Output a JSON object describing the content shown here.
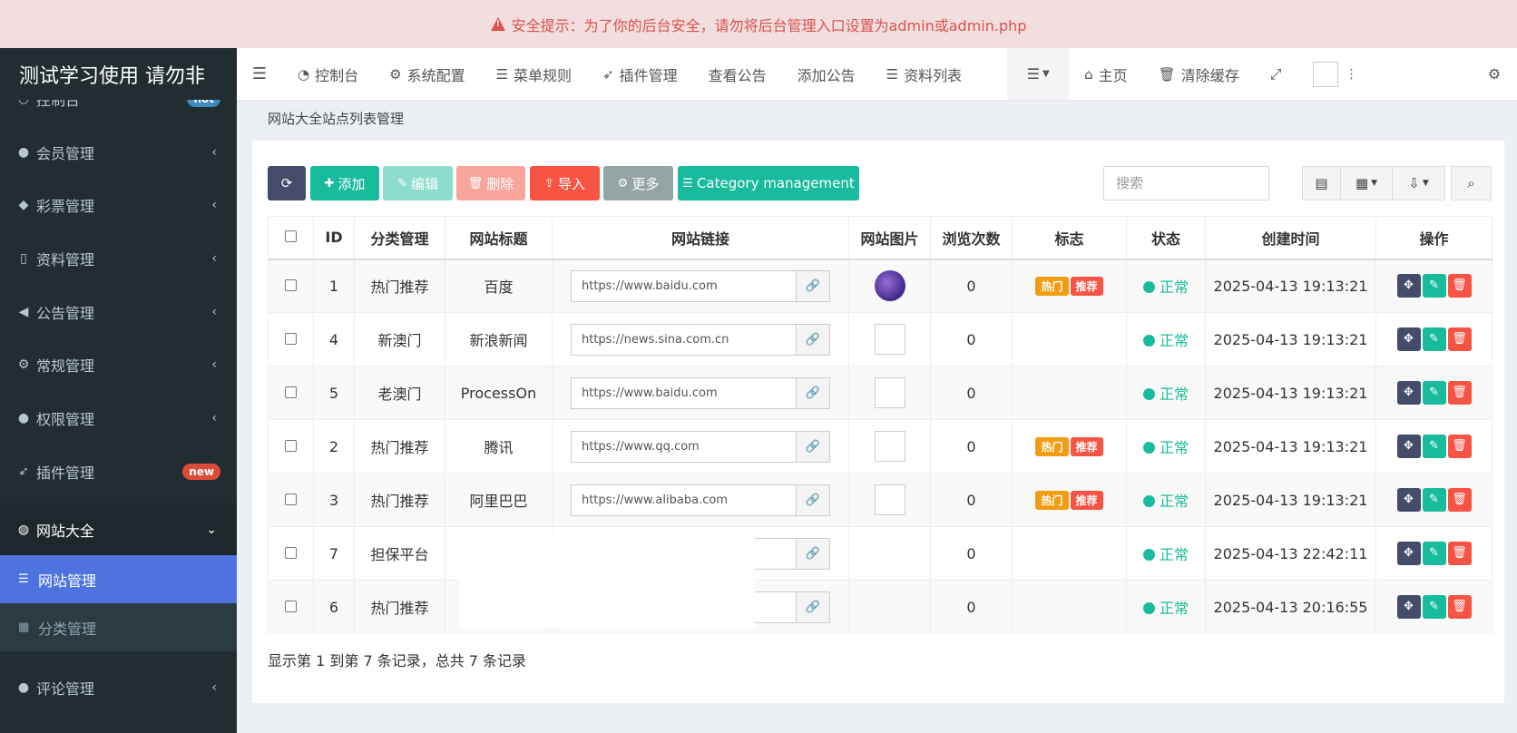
{
  "alert": {
    "text": "安全提示：为了你的后台安全，请勿将后台管理入口设置为admin或admin.php"
  },
  "sidebar": {
    "brand": "测试学习使用 请勿非",
    "items": [
      {
        "label": "控制台",
        "icon": "dashboard-icon",
        "badge": "hot",
        "badge_color": "#3c8dbc"
      },
      {
        "label": "会员管理",
        "icon": "user-icon"
      },
      {
        "label": "彩票管理",
        "icon": "ticket-icon"
      },
      {
        "label": "资料管理",
        "icon": "file-icon"
      },
      {
        "label": "公告管理",
        "icon": "bullhorn-icon"
      },
      {
        "label": "常规管理",
        "icon": "cogs-icon"
      },
      {
        "label": "权限管理",
        "icon": "group-icon"
      },
      {
        "label": "插件管理",
        "icon": "rocket-icon",
        "badge": "new",
        "badge_color": "#dd4b39"
      },
      {
        "label": "网站大全",
        "icon": "globe-icon"
      },
      {
        "label": "评论管理",
        "icon": "comments-icon"
      }
    ],
    "sub_items": [
      {
        "label": "网站管理",
        "icon": "list-icon"
      },
      {
        "label": "分类管理",
        "icon": "grid-icon"
      }
    ]
  },
  "topnav": {
    "items": [
      "控制台",
      "系统配置",
      "菜单规则",
      "插件管理",
      "查看公告",
      "添加公告",
      "资料列表"
    ],
    "home": "主页",
    "clear_cache": "清除缓存"
  },
  "page": {
    "breadcrumb": "网站大全站点列表管理",
    "toolbar": {
      "add": "添加",
      "edit": "编辑",
      "delete": "删除",
      "import": "导入",
      "more": "更多",
      "category": "Category management",
      "search_placeholder": "搜索"
    },
    "columns": [
      "ID",
      "分类管理",
      "网站标题",
      "网站链接",
      "网站图片",
      "浏览次数",
      "标志",
      "状态",
      "创建时间",
      "操作"
    ],
    "rows": [
      {
        "id": "1",
        "category": "热门推荐",
        "title": "百度",
        "url": "https://www.baidu.com",
        "image": "logo",
        "views": "0",
        "tags": [
          "热门",
          "推荐"
        ],
        "status": "正常",
        "created": "2025-04-13 19:13:21"
      },
      {
        "id": "4",
        "category": "新澳门",
        "title": "新浪新闻",
        "url": "https://news.sina.com.cn",
        "image": "broken",
        "views": "0",
        "tags": [],
        "status": "正常",
        "created": "2025-04-13 19:13:21"
      },
      {
        "id": "5",
        "category": "老澳门",
        "title": "ProcessOn",
        "url": "https://www.baidu.com",
        "image": "broken",
        "views": "0",
        "tags": [],
        "status": "正常",
        "created": "2025-04-13 19:13:21"
      },
      {
        "id": "2",
        "category": "热门推荐",
        "title": "腾讯",
        "url": "https://www.qq.com",
        "image": "broken",
        "views": "0",
        "tags": [
          "热门",
          "推荐"
        ],
        "status": "正常",
        "created": "2025-04-13 19:13:21"
      },
      {
        "id": "3",
        "category": "热门推荐",
        "title": "阿里巴巴",
        "url": "https://www.alibaba.com",
        "image": "broken",
        "views": "0",
        "tags": [
          "热门",
          "推荐"
        ],
        "status": "正常",
        "created": "2025-04-13 19:13:21"
      },
      {
        "id": "7",
        "category": "担保平台",
        "title": "",
        "url": "",
        "image": "none",
        "views": "0",
        "tags": [],
        "status": "正常",
        "created": "2025-04-13 22:42:11"
      },
      {
        "id": "6",
        "category": "热门推荐",
        "title": "",
        "url": "",
        "image": "none",
        "views": "0",
        "tags": [],
        "status": "正常",
        "created": "2025-04-13 20:16:55"
      }
    ],
    "footer": "显示第 1 到第 7 条记录，总共 7 条记录"
  },
  "colors": {
    "primary": "#444c69",
    "success": "#18bc9c",
    "danger": "#f75444",
    "warning": "#f39c12",
    "gray": "#95a5a6",
    "active_nav": "#4e73df"
  }
}
